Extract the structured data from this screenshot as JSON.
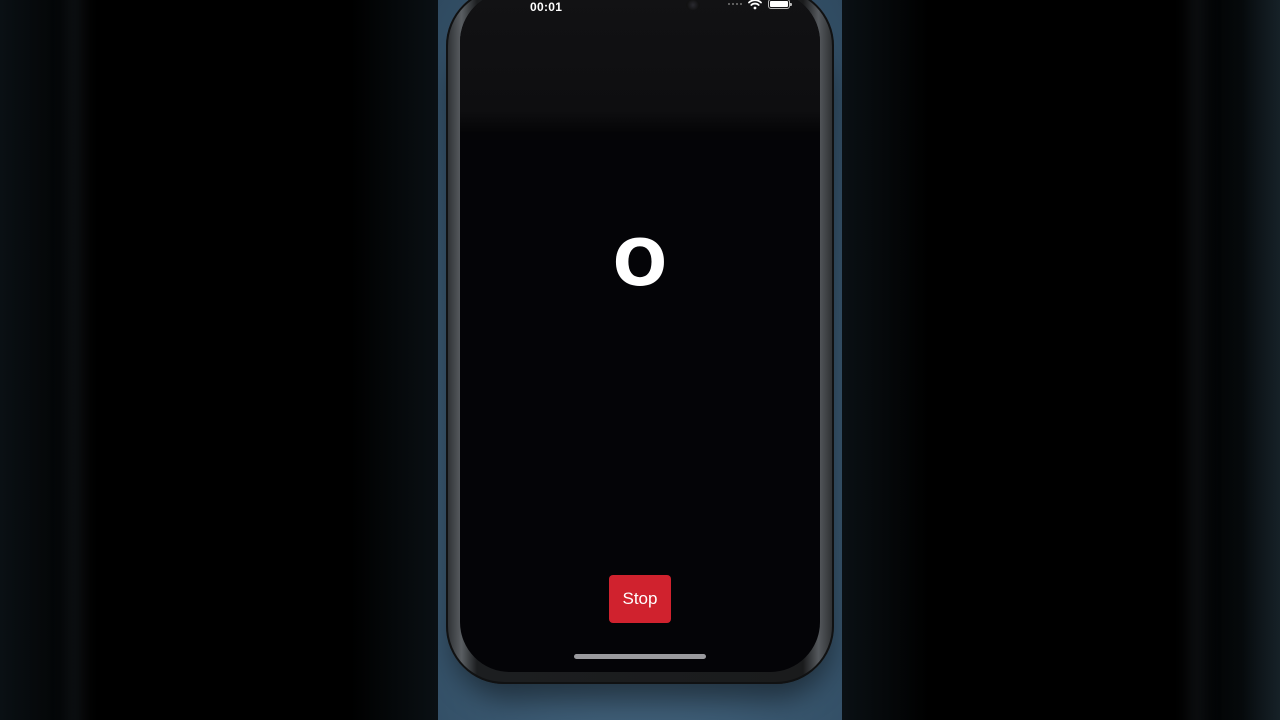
{
  "status_bar": {
    "time": "00:01",
    "icons": [
      "signal-icon",
      "wifi-icon",
      "battery-icon"
    ]
  },
  "main": {
    "display_letter": "O",
    "stop_button_label": "Stop"
  },
  "colors": {
    "screen_background": "#040407",
    "stop_button": "#d0222e",
    "backdrop": "#3d5c75"
  }
}
